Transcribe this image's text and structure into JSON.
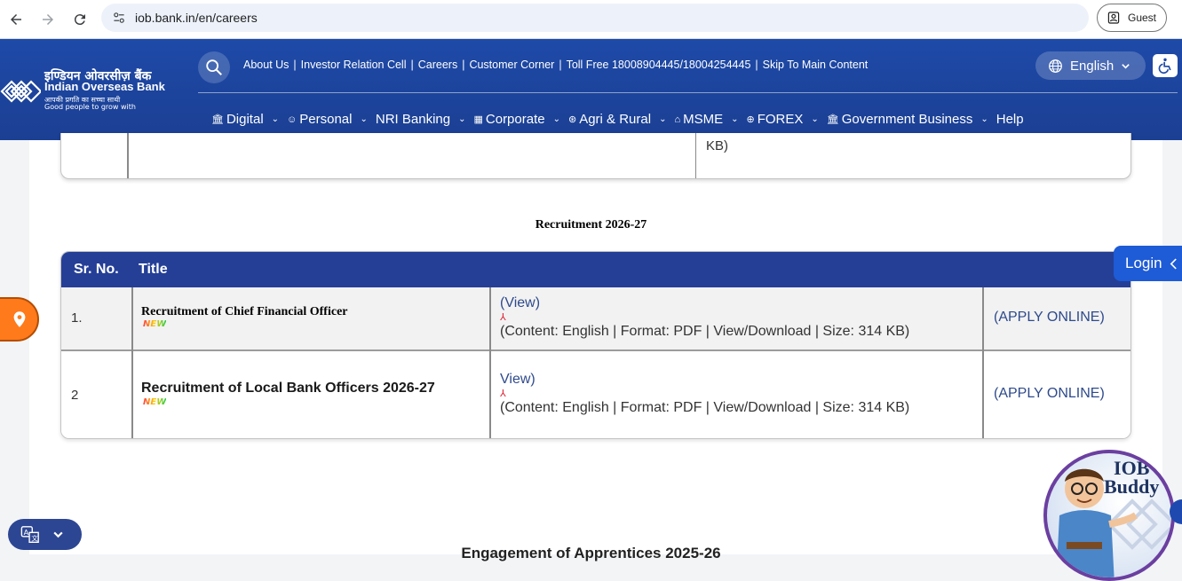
{
  "browser": {
    "url": "iob.bank.in/en/careers",
    "profile_label": "Guest"
  },
  "header": {
    "logo": {
      "hindi_name": "इण्डियन ओवरसीज़ बैंक",
      "english_name": "Indian Overseas Bank",
      "hindi_tagline": "आपकी प्रगति का सच्चा साथी",
      "tagline": "Good people to grow with"
    },
    "top_links": [
      "About Us",
      "Investor Relation Cell",
      "Careers",
      "Customer Corner",
      "Toll Free 18008904445/18004254445",
      "Skip To Main Content"
    ],
    "language": "English",
    "nav": [
      {
        "label": "Digital",
        "icon": "bank-icon",
        "glyph": "🏛",
        "has_menu": true
      },
      {
        "label": "Personal",
        "icon": "person-icon",
        "glyph": "☺",
        "has_menu": true
      },
      {
        "label": "NRI Banking",
        "icon": "",
        "glyph": "",
        "has_menu": true
      },
      {
        "label": "Corporate",
        "icon": "building-icon",
        "glyph": "▦",
        "has_menu": true
      },
      {
        "label": "Agri & Rural",
        "icon": "leaf-icon",
        "glyph": "⊛",
        "has_menu": true
      },
      {
        "label": "MSME",
        "icon": "shop-icon",
        "glyph": "⌂",
        "has_menu": true
      },
      {
        "label": "FOREX",
        "icon": "globe-icon",
        "glyph": "⊕",
        "has_menu": true
      },
      {
        "label": "Government Business",
        "icon": "govt-icon",
        "glyph": "🏛",
        "has_menu": true
      },
      {
        "label": "Help",
        "icon": "",
        "glyph": "",
        "has_menu": false
      }
    ]
  },
  "previous_table": {
    "trailing_text": "KB)"
  },
  "recruitment": {
    "section_title": "Recruitment 2026-27",
    "columns": [
      "Sr. No.",
      "Title"
    ],
    "rows": [
      {
        "sr": "1.",
        "title": "Recruitment of Chief Financial Officer",
        "badge": "NEW",
        "view_label": "(View)",
        "info": "(Content: English | Format: PDF | View/Download | Size: 314 KB)",
        "apply_label": "(APPLY ONLINE)"
      },
      {
        "sr": "2",
        "title": "Recruitment of Local Bank Officers 2026-27",
        "badge": "NEW",
        "view_label": "View)",
        "info": "(Content: English | Format: PDF | View/Download | Size: 314 KB)",
        "apply_label": "(APPLY ONLINE)"
      }
    ]
  },
  "next_section_title": "Engagement of Apprentices 2025-26",
  "widgets": {
    "login_label": "Login",
    "buddy_label_line1": "IOB",
    "buddy_label_line2": "Buddy"
  },
  "colors": {
    "header_blue": "#1e4aa8",
    "table_header": "#253f97",
    "link_blue": "#2e4a8c",
    "location_orange": "#ff7a1a"
  }
}
